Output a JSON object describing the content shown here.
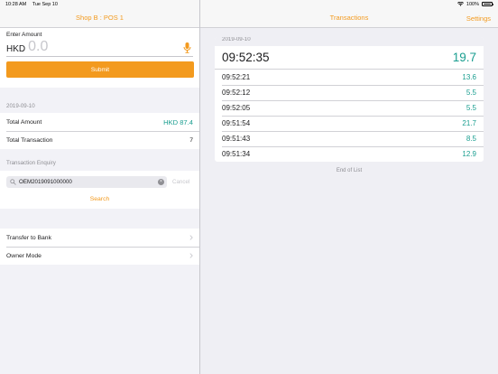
{
  "status": {
    "time": "10:28 AM",
    "date": "Tue Sep 10",
    "battery": "100%"
  },
  "left": {
    "title": "Shop B : POS 1",
    "enter_amount_label": "Enter Amount",
    "currency": "HKD",
    "amount_placeholder": "0.0",
    "submit_label": "Submit",
    "summary_date": "2019-09-10",
    "total_amount_label": "Total Amount",
    "total_amount_value": "HKD 87.4",
    "total_transaction_label": "Total Transaction",
    "total_transaction_value": "7",
    "enquiry_title": "Transaction Enquiry",
    "search_value": "OEM2019091000000",
    "cancel_label": "Cancel",
    "search_label": "Search",
    "menu": [
      {
        "label": "Transfer to Bank"
      },
      {
        "label": "Owner Mode"
      }
    ]
  },
  "right": {
    "title": "Transactions",
    "settings_label": "Settings",
    "date": "2019-09-10",
    "transactions": [
      {
        "time": "09:52:35",
        "amount": "19.7"
      },
      {
        "time": "09:52:21",
        "amount": "13.6"
      },
      {
        "time": "09:52:12",
        "amount": "5.5"
      },
      {
        "time": "09:52:05",
        "amount": "5.5"
      },
      {
        "time": "09:51:54",
        "amount": "21.7"
      },
      {
        "time": "09:51:43",
        "amount": "8.5"
      },
      {
        "time": "09:51:34",
        "amount": "12.9"
      }
    ],
    "end_label": "End of List"
  },
  "colors": {
    "accent": "#f39a1e",
    "amount_green": "#1a9e90"
  },
  "icons": [
    "microphone-icon",
    "magnifier-icon",
    "clear-icon",
    "chevron-right-icon",
    "wifi-icon",
    "battery-icon"
  ]
}
